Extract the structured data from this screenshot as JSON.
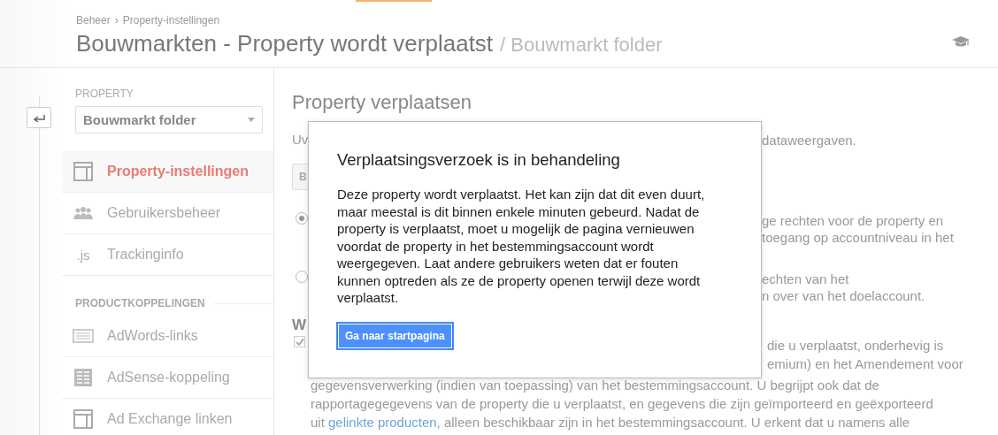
{
  "header": {
    "breadcrumb": [
      "Beheer",
      "Property-instellingen"
    ],
    "breadcrumb_separator": "›",
    "title": "Bouwmarkten - Property wordt verplaatst",
    "subtitle": "/ Bouwmarkt folder"
  },
  "sidebar": {
    "section_label": "PROPERTY",
    "select": {
      "value": "Bouwmarkt folder"
    },
    "items": [
      {
        "label": "Property-instellingen",
        "kind": "layout",
        "selected": true
      },
      {
        "label": "Gebruikersbeheer",
        "kind": "people",
        "selected": false
      },
      {
        "label": "Trackinginfo",
        "kind": "js",
        "icon_text": ".js",
        "selected": false
      }
    ],
    "section2_label": "PRODUCTKOPPELINGEN",
    "items2": [
      {
        "label": "AdWords-links",
        "kind": "adwords",
        "selected": false
      },
      {
        "label": "AdSense-koppeling",
        "kind": "adsense",
        "selected": false
      },
      {
        "label": "Ad Exchange linken",
        "kind": "layout",
        "selected": false
      }
    ]
  },
  "content": {
    "title": "Property verplaatsen",
    "rows": [
      {
        "kind": "text",
        "left": "Uv",
        "right_lines": [
          "dataweergaven."
        ]
      },
      {
        "kind": "button",
        "left": "B"
      },
      {
        "kind": "radio",
        "selected": true,
        "right_lines": [
          "ge rechten voor de property en",
          "toegang op accountniveau in het"
        ]
      },
      {
        "kind": "radio",
        "selected": false,
        "right_lines": [
          "echten van het",
          "n over van het doelaccount."
        ]
      },
      {
        "kind": "heading",
        "left": "W"
      },
      {
        "kind": "checkbox",
        "checked": true,
        "right_lines": [
          "die u verplaatst, onderhevig is",
          "emium) en het Amendement voor"
        ]
      }
    ],
    "paragraph_lines": [
      {
        "text": "gegevensverwerking (indien van toepassing) van het bestemmingsaccount. U begrijpt ook dat de"
      },
      {
        "text": "rapportagegegevens van de property die u verplaatst, en gegevens die zijn geïmporteerd en geëxporteerd"
      },
      {
        "before": "uit ",
        "link": "gelinkte producten",
        "after": ", alleen beschikbaar zijn in het bestemmingsaccount. U erkent dat u namens alle"
      }
    ]
  },
  "modal": {
    "title": "Verplaatsingsverzoek is in behandeling",
    "body": "Deze property wordt verplaatst. Het kan zijn dat dit even duurt, maar meestal is dit binnen enkele minuten gebeurd. Nadat de property is verplaatst, moet u mogelijk de pagina vernieuwen voordat de property in het bestemmingsaccount wordt weergegeven. Laat andere gebruikers weten dat er fouten kunnen optreden als ze de property openen terwijl deze wordt verplaatst.",
    "button": "Ga naar startpagina"
  }
}
